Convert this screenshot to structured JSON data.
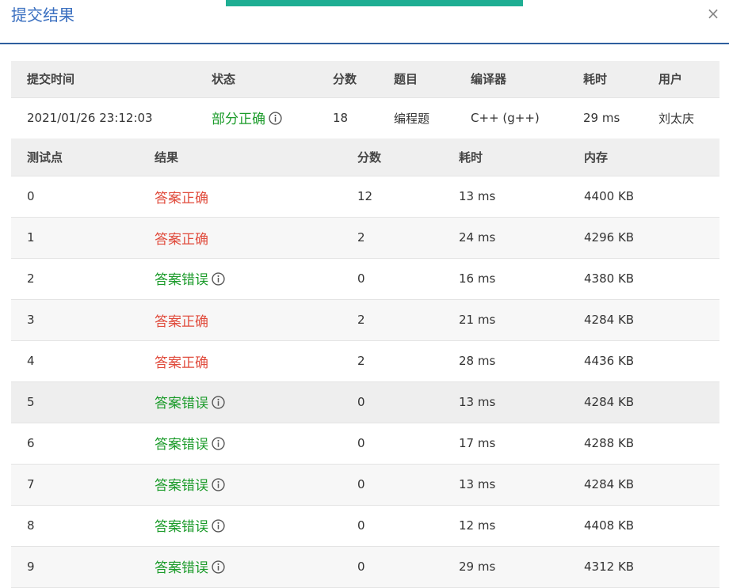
{
  "dialog": {
    "title": "提交结果",
    "close_glyph": "×"
  },
  "summary": {
    "headers": [
      "提交时间",
      "状态",
      "分数",
      "题目",
      "编译器",
      "耗时",
      "用户"
    ],
    "time": "2021/01/26 23:12:03",
    "status": "部分正确",
    "score": "18",
    "problem": "编程题",
    "compiler": "C++ (g++)",
    "elapsed": "29 ms",
    "user": "刘太庆"
  },
  "cases": {
    "headers": [
      "测试点",
      "结果",
      "分数",
      "耗时",
      "内存"
    ],
    "rows": [
      {
        "id": "0",
        "result": "答案正确",
        "score": "12",
        "time": "13 ms",
        "memory": "4400 KB"
      },
      {
        "id": "1",
        "result": "答案正确",
        "score": "2",
        "time": "24 ms",
        "memory": "4296 KB"
      },
      {
        "id": "2",
        "result": "答案错误",
        "score": "0",
        "time": "16 ms",
        "memory": "4380 KB"
      },
      {
        "id": "3",
        "result": "答案正确",
        "score": "2",
        "time": "21 ms",
        "memory": "4284 KB"
      },
      {
        "id": "4",
        "result": "答案正确",
        "score": "2",
        "time": "28 ms",
        "memory": "4436 KB"
      },
      {
        "id": "5",
        "result": "答案错误",
        "score": "0",
        "time": "13 ms",
        "memory": "4284 KB"
      },
      {
        "id": "6",
        "result": "答案错误",
        "score": "0",
        "time": "17 ms",
        "memory": "4288 KB"
      },
      {
        "id": "7",
        "result": "答案错误",
        "score": "0",
        "time": "13 ms",
        "memory": "4284 KB"
      },
      {
        "id": "8",
        "result": "答案错误",
        "score": "0",
        "time": "12 ms",
        "memory": "4408 KB"
      },
      {
        "id": "9",
        "result": "答案错误",
        "score": "0",
        "time": "29 ms",
        "memory": "4312 KB"
      }
    ]
  },
  "colors": {
    "accent_bar": "#1fae93",
    "title_blue": "#3a6fc0",
    "correct_red": "#e04b3c",
    "wrong_green": "#1b9b2a"
  },
  "icons": {
    "info": "info-circle-icon",
    "close": "close-icon"
  }
}
